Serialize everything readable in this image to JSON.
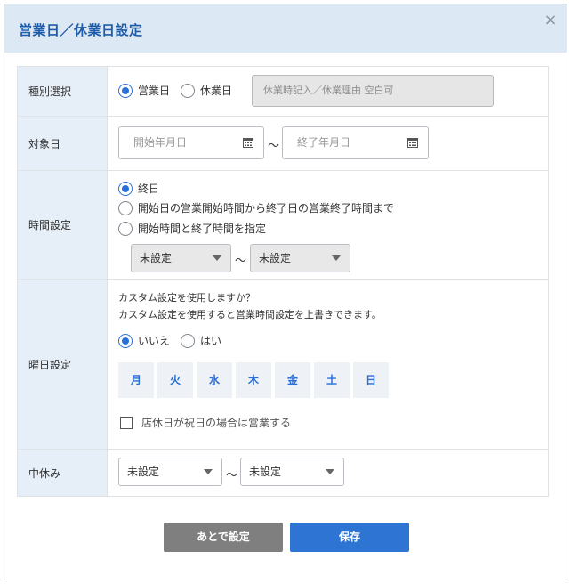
{
  "dialog": {
    "title": "営業日／休業日設定",
    "close_symbol": "×"
  },
  "rows": {
    "type_select": {
      "label": "種別選択",
      "options": [
        {
          "label": "営業日",
          "checked": true
        },
        {
          "label": "休業日",
          "checked": false
        }
      ],
      "note_placeholder": "休業時記入／休業理由 空白可"
    },
    "target_date": {
      "label": "対象日",
      "start_placeholder": "開始年月日",
      "end_placeholder": "終了年月日",
      "separator": "～"
    },
    "time_setting": {
      "label": "時間設定",
      "options": [
        {
          "label": "終日",
          "checked": true
        },
        {
          "label": "開始日の営業開始時間から終了日の営業終了時間まで",
          "checked": false
        },
        {
          "label": "開始時間と終了時間を指定",
          "checked": false
        }
      ],
      "start_select": "未設定",
      "end_select": "未設定",
      "separator": "～"
    },
    "weekday_setting": {
      "label": "曜日設定",
      "question": "カスタム設定を使用しますか？",
      "description": "カスタム設定を使用すると営業時間設定を上書きできます。",
      "options": [
        {
          "label": "いいえ",
          "checked": true
        },
        {
          "label": "はい",
          "checked": false
        }
      ],
      "days": [
        "月",
        "火",
        "水",
        "木",
        "金",
        "土",
        "日"
      ],
      "holiday_checkbox_label": "店休日が祝日の場合は営業する",
      "holiday_checked": false
    },
    "break": {
      "label": "中休み",
      "start_select": "未設定",
      "end_select": "未設定",
      "separator": "～"
    }
  },
  "buttons": {
    "later": "あとで設定",
    "save": "保存"
  },
  "colors": {
    "accent": "#2a6fd8",
    "header_bg": "#dce8f4",
    "label_bg": "#e6eef7",
    "save_button": "#2e75d3",
    "later_button": "#7f7f7f"
  }
}
